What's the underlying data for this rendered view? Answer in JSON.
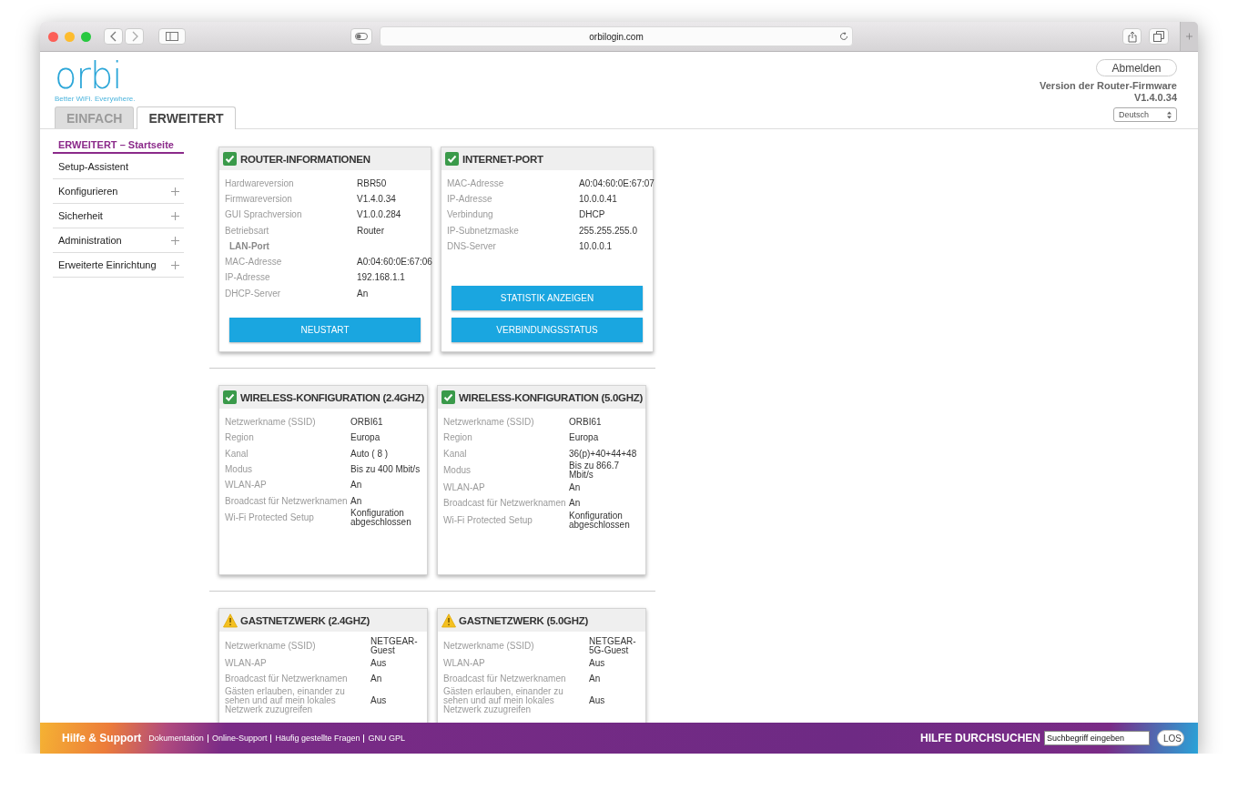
{
  "browser": {
    "url": "orbilogin.com"
  },
  "header": {
    "logo": "orbi",
    "tagline": "Better WiFi. Everywhere.",
    "logout": "Abmelden",
    "firmware_label": "Version der Router-Firmware",
    "firmware_version": "V1.4.0.34",
    "language": "Deutsch"
  },
  "tabs": [
    {
      "label": "EINFACH",
      "selected": false
    },
    {
      "label": "ERWEITERT",
      "selected": true
    }
  ],
  "sidebar": {
    "items": [
      {
        "label": "ERWEITERT – Startseite",
        "selected": true,
        "expandable": false
      },
      {
        "label": "Setup-Assistent",
        "selected": false,
        "expandable": false
      },
      {
        "label": "Konfigurieren",
        "selected": false,
        "expandable": true
      },
      {
        "label": "Sicherheit",
        "selected": false,
        "expandable": true
      },
      {
        "label": "Administration",
        "selected": false,
        "expandable": true
      },
      {
        "label": "Erweiterte Einrichtung",
        "selected": false,
        "expandable": true
      }
    ]
  },
  "sections": [
    [
      {
        "title": "ROUTER-INFORMATIONEN",
        "kind": "ok",
        "rows": [
          {
            "kind": "pair",
            "label": "Hardwareversion",
            "value": "RBR50"
          },
          {
            "kind": "pair",
            "label": "Firmwareversion",
            "value": "V1.4.0.34"
          },
          {
            "kind": "pair",
            "label": "GUI Sprachversion",
            "value": "V1.0.0.284"
          },
          {
            "kind": "pair",
            "label": "Betriebsart",
            "value": "Router"
          },
          {
            "kind": "heading",
            "label": "LAN-Port"
          },
          {
            "kind": "pair",
            "label": "MAC-Adresse",
            "value": "A0:04:60:0E:67:06"
          },
          {
            "kind": "pair",
            "label": "IP-Adresse",
            "value": "192.168.1.1"
          },
          {
            "kind": "pair",
            "label": "DHCP-Server",
            "value": "An"
          }
        ],
        "buttons": [
          "NEUSTART"
        ]
      },
      {
        "title": "INTERNET-PORT",
        "kind": "ok",
        "rows": [
          {
            "kind": "pair",
            "label": "MAC-Adresse",
            "value": "A0:04:60:0E:67:07"
          },
          {
            "kind": "pair",
            "label": "IP-Adresse",
            "value": "10.0.0.41"
          },
          {
            "kind": "pair",
            "label": "Verbindung",
            "value": "DHCP"
          },
          {
            "kind": "pair",
            "label": "IP-Subnetzmaske",
            "value": "255.255.255.0"
          },
          {
            "kind": "pair",
            "label": "DNS-Server",
            "value": "10.0.0.1"
          }
        ],
        "buttons": [
          "STATISTIK ANZEIGEN",
          "VERBINDUNGSSTATUS"
        ]
      }
    ],
    [
      {
        "title": "WIRELESS-KONFIGURATION (2.4GHZ)",
        "kind": "ok",
        "rows": [
          {
            "kind": "pair",
            "label": "Netzwerkname (SSID)",
            "value": "ORBI61"
          },
          {
            "kind": "pair",
            "label": "Region",
            "value": "Europa"
          },
          {
            "kind": "pair",
            "label": "Kanal",
            "value": "Auto ( 8 )"
          },
          {
            "kind": "pair",
            "label": "Modus",
            "value": "Bis zu 400 Mbit/s"
          },
          {
            "kind": "pair",
            "label": "WLAN-AP",
            "value": "An"
          },
          {
            "kind": "pair",
            "label": "Broadcast für Netzwerknamen",
            "value": "An"
          },
          {
            "kind": "pair",
            "label": "Wi-Fi Protected Setup",
            "value": "Konfiguration abgeschlossen"
          }
        ]
      },
      {
        "title": "WIRELESS-KONFIGURATION (5.0GHZ)",
        "kind": "ok",
        "rows": [
          {
            "kind": "pair",
            "label": "Netzwerkname (SSID)",
            "value": "ORBI61"
          },
          {
            "kind": "pair",
            "label": "Region",
            "value": "Europa"
          },
          {
            "kind": "pair",
            "label": "Kanal",
            "value": "36(p)+40+44+48"
          },
          {
            "kind": "pair",
            "label": "Modus",
            "value": "Bis zu 866.7 Mbit/s"
          },
          {
            "kind": "pair",
            "label": "WLAN-AP",
            "value": "An"
          },
          {
            "kind": "pair",
            "label": "Broadcast für Netzwerknamen",
            "value": "An"
          },
          {
            "kind": "pair",
            "label": "Wi-Fi Protected Setup",
            "value": "Konfiguration abgeschlossen"
          }
        ]
      }
    ],
    [
      {
        "title": "GASTNETZWERK (2.4GHZ)",
        "kind": "warning",
        "rows": [
          {
            "kind": "pair",
            "label": "Netzwerkname (SSID)",
            "value": "NETGEAR-Guest"
          },
          {
            "kind": "pair",
            "label": "WLAN-AP",
            "value": "Aus"
          },
          {
            "kind": "pair",
            "label": "Broadcast für Netzwerknamen",
            "value": "An"
          },
          {
            "kind": "pair",
            "label": "Gästen erlauben, einander zu sehen und auf mein lokales Netzwerk zuzugreifen",
            "value": "Aus"
          }
        ]
      },
      {
        "title": "GASTNETZWERK (5.0GHZ)",
        "kind": "warning",
        "rows": [
          {
            "kind": "pair",
            "label": "Netzwerkname (SSID)",
            "value": "NETGEAR-5G-Guest"
          },
          {
            "kind": "pair",
            "label": "WLAN-AP",
            "value": "Aus"
          },
          {
            "kind": "pair",
            "label": "Broadcast für Netzwerknamen",
            "value": "An"
          },
          {
            "kind": "pair",
            "label": "Gästen erlauben, einander zu sehen und auf mein lokales Netzwerk zuzugreifen",
            "value": "Aus"
          }
        ]
      }
    ]
  ],
  "footer": {
    "title": "Hilfe & Support",
    "links": [
      "Dokumentation",
      "Online-Support",
      "Häufig gestellte Fragen",
      "GNU GPL"
    ],
    "search_label": "HILFE DURCHSUCHEN",
    "search_placeholder": "Suchbegriff eingeben",
    "search_button": "LOS"
  }
}
